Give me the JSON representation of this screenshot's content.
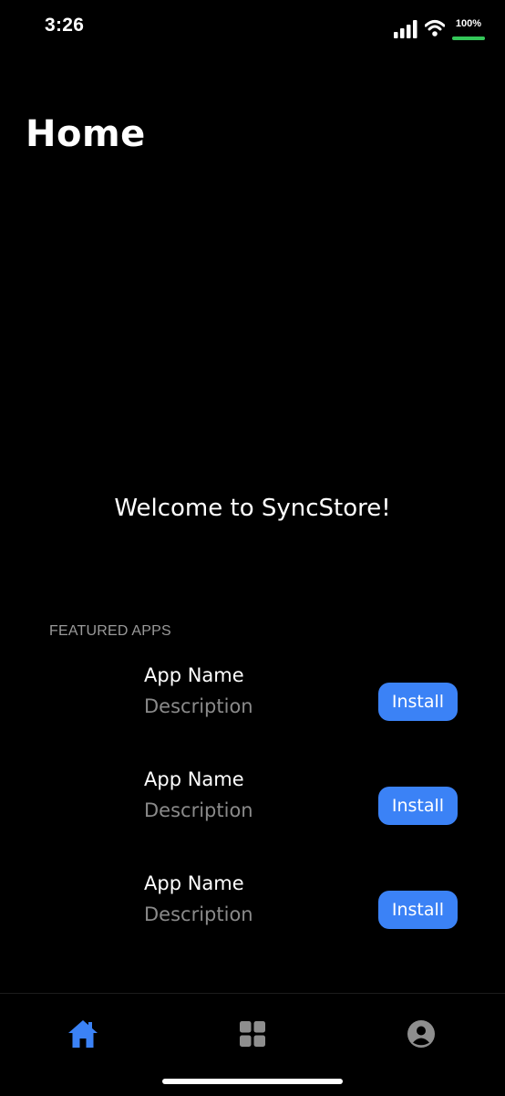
{
  "status_bar": {
    "time": "3:26",
    "battery_text": "100%",
    "battery_level": 1.0,
    "signal_icon": "cellular-signal-icon",
    "wifi_icon": "wifi-icon"
  },
  "header": {
    "title": "Home"
  },
  "main": {
    "welcome_text": "Welcome to SyncStore!",
    "featured_label": "FEATURED APPS",
    "apps": [
      {
        "name": "App Name",
        "description": "Description",
        "action_label": "Install"
      },
      {
        "name": "App Name",
        "description": "Description",
        "action_label": "Install"
      },
      {
        "name": "App Name",
        "description": "Description",
        "action_label": "Install"
      }
    ]
  },
  "tab_bar": {
    "tabs": [
      {
        "icon": "home-icon",
        "active": true
      },
      {
        "icon": "grid-icon",
        "active": false
      },
      {
        "icon": "profile-icon",
        "active": false
      }
    ]
  },
  "colors": {
    "background": "#000000",
    "accent": "#3b82f6",
    "battery_green": "#34c759",
    "inactive_icon": "#8e8e8e",
    "muted_text": "#8a8a8a"
  }
}
